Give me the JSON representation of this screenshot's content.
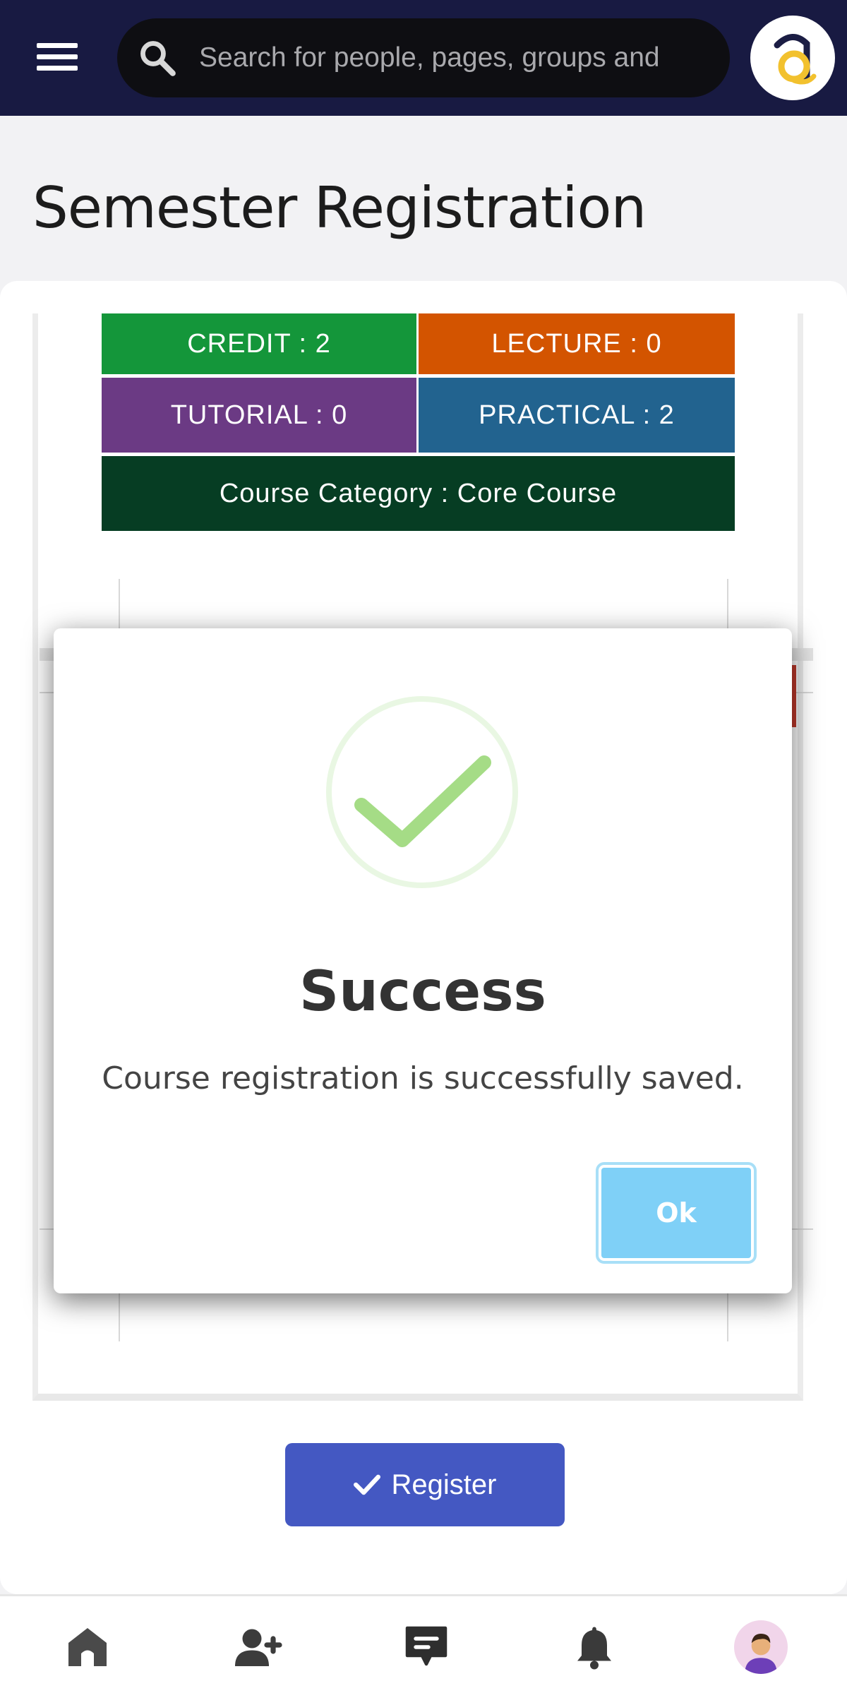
{
  "header": {
    "search_placeholder": "Search for people, pages, groups and"
  },
  "page": {
    "title": "Semester Registration"
  },
  "course_tiles": {
    "credit": "CREDIT : 2",
    "lecture": "LECTURE : 0",
    "tutorial": "TUTORIAL : 0",
    "practical": "PRACTICAL : 2",
    "category": "Course Category : Core Course"
  },
  "dialog": {
    "title": "Success",
    "message": "Course registration is successfully saved.",
    "ok_label": "Ok"
  },
  "actions": {
    "register_label": "Register"
  },
  "colors": {
    "header_bg": "#181a42",
    "credit": "#14963a",
    "lecture": "#d35400",
    "tutorial": "#6b3a84",
    "practical": "#22638f",
    "category": "#063d23",
    "register": "#4458c2",
    "ok": "#7fd0f7",
    "success_check": "#a5dc86"
  },
  "bottom_nav": {
    "icons": [
      "home-icon",
      "add-friend-icon",
      "chat-icon",
      "bell-icon",
      "profile-avatar"
    ]
  }
}
